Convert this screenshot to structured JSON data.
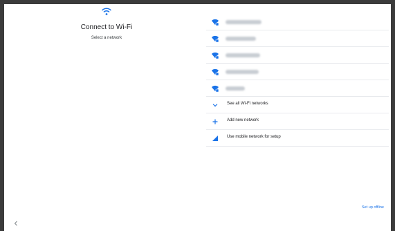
{
  "header": {
    "title": "Connect to Wi-Fi",
    "subtitle": "Select a network"
  },
  "networks": [
    {
      "icon": "wifi-lock-icon"
    },
    {
      "icon": "wifi-lock-icon"
    },
    {
      "icon": "wifi-lock-icon"
    },
    {
      "icon": "wifi-lock-icon"
    },
    {
      "icon": "wifi-lock-icon"
    }
  ],
  "actions": {
    "see_all": "See all Wi-Fi networks",
    "add_new": "Add new network",
    "mobile": "Use mobile network for setup"
  },
  "footer": {
    "setup_offline": "Set up offline"
  },
  "colors": {
    "accent": "#1a73e8",
    "text": "#202124",
    "divider": "#e8eaed"
  }
}
